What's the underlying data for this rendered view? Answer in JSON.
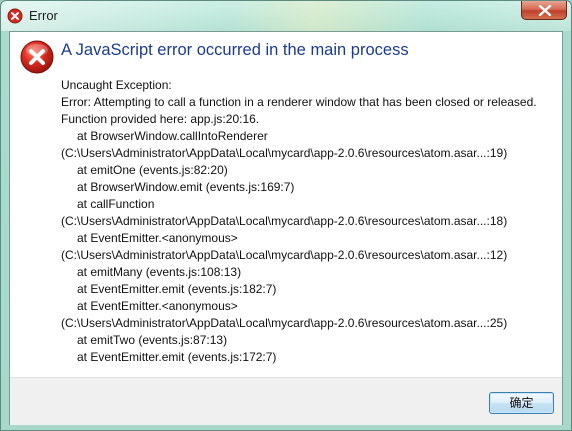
{
  "window": {
    "title": "Error"
  },
  "dialog": {
    "main_instruction": "A JavaScript error occurred in the main process",
    "icon": "error-icon",
    "message_lines": [
      "Uncaught Exception:",
      "Error: Attempting to call a function in a renderer window that has been closed or released. Function provided here: app.js:20:16.",
      "at BrowserWindow.callIntoRenderer",
      "(C:\\Users\\Administrator\\AppData\\Local\\mycard\\app-2.0.6\\resources\\atom.asar...:19)",
      "at emitOne (events.js:82:20)",
      "at BrowserWindow.emit (events.js:169:7)",
      "at callFunction",
      "(C:\\Users\\Administrator\\AppData\\Local\\mycard\\app-2.0.6\\resources\\atom.asar...:18)",
      "at EventEmitter.<anonymous>",
      "(C:\\Users\\Administrator\\AppData\\Local\\mycard\\app-2.0.6\\resources\\atom.asar...:12)",
      "at emitMany (events.js:108:13)",
      "at EventEmitter.emit (events.js:182:7)",
      "at EventEmitter.<anonymous>",
      "(C:\\Users\\Administrator\\AppData\\Local\\mycard\\app-2.0.6\\resources\\atom.asar...:25)",
      "at emitTwo (events.js:87:13)",
      "at EventEmitter.emit (events.js:172:7)"
    ],
    "ok_label": "确定"
  },
  "colors": {
    "instruction_text": "#1b3c8c",
    "error_red": "#cc2020",
    "close_button": "#c74a33"
  }
}
